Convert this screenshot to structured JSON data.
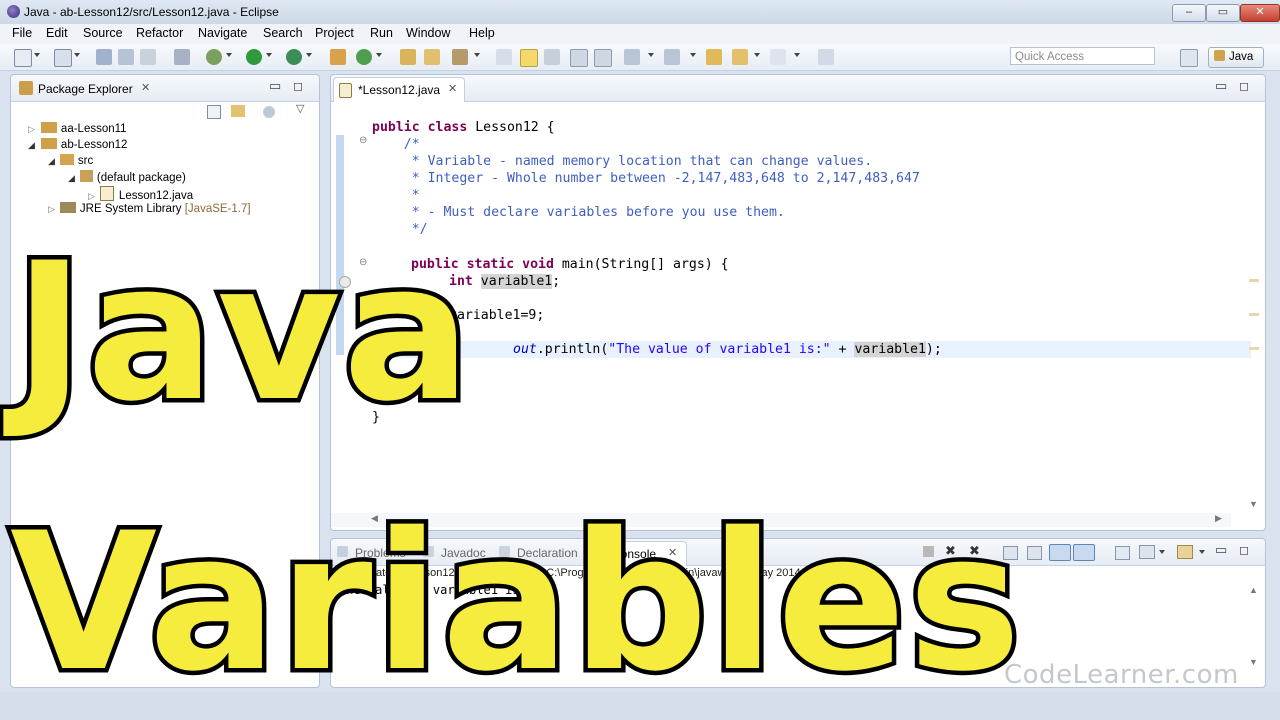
{
  "window": {
    "title": "Java - ab-Lesson12/src/Lesson12.java - Eclipse",
    "min": "–",
    "max": "▭",
    "close": "✕"
  },
  "menu": [
    "File",
    "Edit",
    "Source",
    "Refactor",
    "Navigate",
    "Search",
    "Project",
    "Run",
    "Window",
    "Help"
  ],
  "toolbar": {
    "quick_access_placeholder": "Quick Access",
    "perspective": "Java"
  },
  "package_explorer": {
    "tab_label": "Package Explorer",
    "tree": [
      {
        "label": "aa-Lesson11",
        "level": 0
      },
      {
        "label": "ab-Lesson12",
        "level": 0
      },
      {
        "label": "src",
        "level": 1
      },
      {
        "label": "(default package)",
        "level": 2
      },
      {
        "label": "Lesson12.java",
        "level": 3
      },
      {
        "label": "JRE System Library",
        "suffix": "[JavaSE-1.7]",
        "level": 1
      }
    ]
  },
  "editor": {
    "tab_label": "*Lesson12.java",
    "lines": {
      "l1_kw": "public class",
      "l1_rest": " Lesson12 {",
      "l2": "    /*",
      "l3": "     * Variable - named memory location that can change values.",
      "l4": "     * Integer - Whole number between -2,147,483,648 to 2,147,483,647",
      "l5": "     *",
      "l6": "     * - Must declare variables before you use them.",
      "l7": "     */",
      "l8_kw": "public static void",
      "l8_rest": " main(String[] args) {",
      "l9_kw": "int",
      "l9_var": "variable1",
      "l9_end": ";",
      "l10": "variable1=9;",
      "l11_a": ".println(",
      "l11_str": "\"The value of variable1 is:\"",
      "l11_plus": " + ",
      "l11_var": "variable1",
      "l11_end": ");",
      "l11_out": "out",
      "l12": "}"
    }
  },
  "bottom_panel": {
    "tabs": [
      "Problems",
      "Javadoc",
      "Declaration",
      "Console"
    ],
    "console_line": "<terminated> Lesson12 [Java Application] C:\\Program Files\\Java\\jre7\\bin\\javaw.exe (May 2014 12:58:27 PM)",
    "console_out": "The value of variable1 is:9"
  },
  "overlay": {
    "line1": "Java",
    "line2": "Variables"
  },
  "watermark": "CodeLearner.com"
}
